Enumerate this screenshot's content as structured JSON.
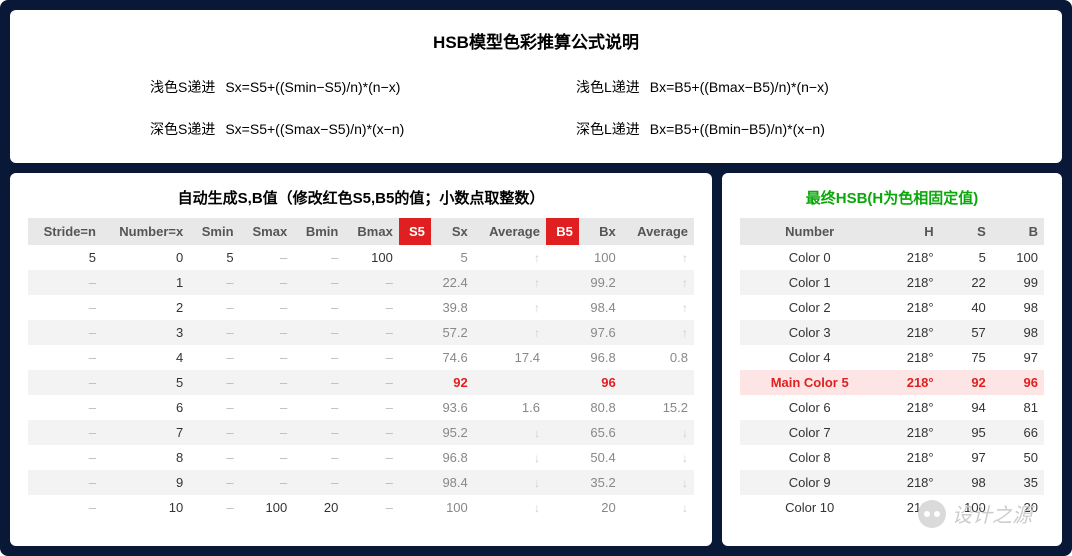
{
  "top": {
    "title": "HSB模型色彩推算公式说明",
    "formulas": [
      {
        "label": "浅色S递进",
        "text": "Sx=S5+((Smin−S5)/n)*(n−x)"
      },
      {
        "label": "浅色L递进",
        "text": "Bx=B5+((Bmax−B5)/n)*(n−x)"
      },
      {
        "label": "深色S递进",
        "text": "Sx=S5+((Smax−S5)/n)*(x−n)"
      },
      {
        "label": "深色L递进",
        "text": "Bx=B5+((Bmin−B5)/n)*(x−n)"
      }
    ]
  },
  "left": {
    "title": "自动生成S,B值（修改红色S5,B5的值；小数点取整数）",
    "headers": [
      "Stride=n",
      "Number=x",
      "Smin",
      "Smax",
      "Bmin",
      "Bmax",
      "S5",
      "Sx",
      "Average",
      "B5",
      "Bx",
      "Average"
    ],
    "rows": [
      {
        "stride": "5",
        "num": "0",
        "smin": "5",
        "smax": "–",
        "bmin": "–",
        "bmax": "100",
        "s5": "",
        "sx": "5",
        "savg": "↑",
        "b5": "",
        "bx": "100",
        "bavg": "↑",
        "hl": false,
        "even": false
      },
      {
        "stride": "–",
        "num": "1",
        "smin": "–",
        "smax": "–",
        "bmin": "–",
        "bmax": "–",
        "s5": "",
        "sx": "22.4",
        "savg": "↑",
        "b5": "",
        "bx": "99.2",
        "bavg": "↑",
        "hl": false,
        "even": true
      },
      {
        "stride": "–",
        "num": "2",
        "smin": "–",
        "smax": "–",
        "bmin": "–",
        "bmax": "–",
        "s5": "",
        "sx": "39.8",
        "savg": "↑",
        "b5": "",
        "bx": "98.4",
        "bavg": "↑",
        "hl": false,
        "even": false
      },
      {
        "stride": "–",
        "num": "3",
        "smin": "–",
        "smax": "–",
        "bmin": "–",
        "bmax": "–",
        "s5": "",
        "sx": "57.2",
        "savg": "↑",
        "b5": "",
        "bx": "97.6",
        "bavg": "↑",
        "hl": false,
        "even": true
      },
      {
        "stride": "–",
        "num": "4",
        "smin": "–",
        "smax": "–",
        "bmin": "–",
        "bmax": "–",
        "s5": "",
        "sx": "74.6",
        "savg": "17.4",
        "b5": "",
        "bx": "96.8",
        "bavg": "0.8",
        "hl": false,
        "even": false
      },
      {
        "stride": "–",
        "num": "5",
        "smin": "–",
        "smax": "–",
        "bmin": "–",
        "bmax": "–",
        "s5": "",
        "sx": "92",
        "savg": "",
        "b5": "",
        "bx": "96",
        "bavg": "",
        "hl": true,
        "even": true
      },
      {
        "stride": "–",
        "num": "6",
        "smin": "–",
        "smax": "–",
        "bmin": "–",
        "bmax": "–",
        "s5": "",
        "sx": "93.6",
        "savg": "1.6",
        "b5": "",
        "bx": "80.8",
        "bavg": "15.2",
        "hl": false,
        "even": false
      },
      {
        "stride": "–",
        "num": "7",
        "smin": "–",
        "smax": "–",
        "bmin": "–",
        "bmax": "–",
        "s5": "",
        "sx": "95.2",
        "savg": "↓",
        "b5": "",
        "bx": "65.6",
        "bavg": "↓",
        "hl": false,
        "even": true
      },
      {
        "stride": "–",
        "num": "8",
        "smin": "–",
        "smax": "–",
        "bmin": "–",
        "bmax": "–",
        "s5": "",
        "sx": "96.8",
        "savg": "↓",
        "b5": "",
        "bx": "50.4",
        "bavg": "↓",
        "hl": false,
        "even": false
      },
      {
        "stride": "–",
        "num": "9",
        "smin": "–",
        "smax": "–",
        "bmin": "–",
        "bmax": "–",
        "s5": "",
        "sx": "98.4",
        "savg": "↓",
        "b5": "",
        "bx": "35.2",
        "bavg": "↓",
        "hl": false,
        "even": true
      },
      {
        "stride": "–",
        "num": "10",
        "smin": "–",
        "smax": "100",
        "bmin": "20",
        "bmax": "–",
        "s5": "",
        "sx": "100",
        "savg": "↓",
        "b5": "",
        "bx": "20",
        "bavg": "↓",
        "hl": false,
        "even": false
      }
    ]
  },
  "right": {
    "title": "最终HSB(H为色相固定值)",
    "headers": [
      "Number",
      "H",
      "S",
      "B"
    ],
    "rows": [
      {
        "name": "Color 0",
        "h": "218°",
        "s": "5",
        "b": "100",
        "main": false,
        "even": false
      },
      {
        "name": "Color 1",
        "h": "218°",
        "s": "22",
        "b": "99",
        "main": false,
        "even": true
      },
      {
        "name": "Color 2",
        "h": "218°",
        "s": "40",
        "b": "98",
        "main": false,
        "even": false
      },
      {
        "name": "Color 3",
        "h": "218°",
        "s": "57",
        "b": "98",
        "main": false,
        "even": true
      },
      {
        "name": "Color 4",
        "h": "218°",
        "s": "75",
        "b": "97",
        "main": false,
        "even": false
      },
      {
        "name": "Main Color 5",
        "h": "218°",
        "s": "92",
        "b": "96",
        "main": true,
        "even": true
      },
      {
        "name": "Color 6",
        "h": "218°",
        "s": "94",
        "b": "81",
        "main": false,
        "even": false
      },
      {
        "name": "Color 7",
        "h": "218°",
        "s": "95",
        "b": "66",
        "main": false,
        "even": true
      },
      {
        "name": "Color 8",
        "h": "218°",
        "s": "97",
        "b": "50",
        "main": false,
        "even": false
      },
      {
        "name": "Color 9",
        "h": "218°",
        "s": "98",
        "b": "35",
        "main": false,
        "even": true
      },
      {
        "name": "Color 10",
        "h": "218°",
        "s": "100",
        "b": "20",
        "main": false,
        "even": false
      }
    ]
  },
  "watermark": "设计之源"
}
